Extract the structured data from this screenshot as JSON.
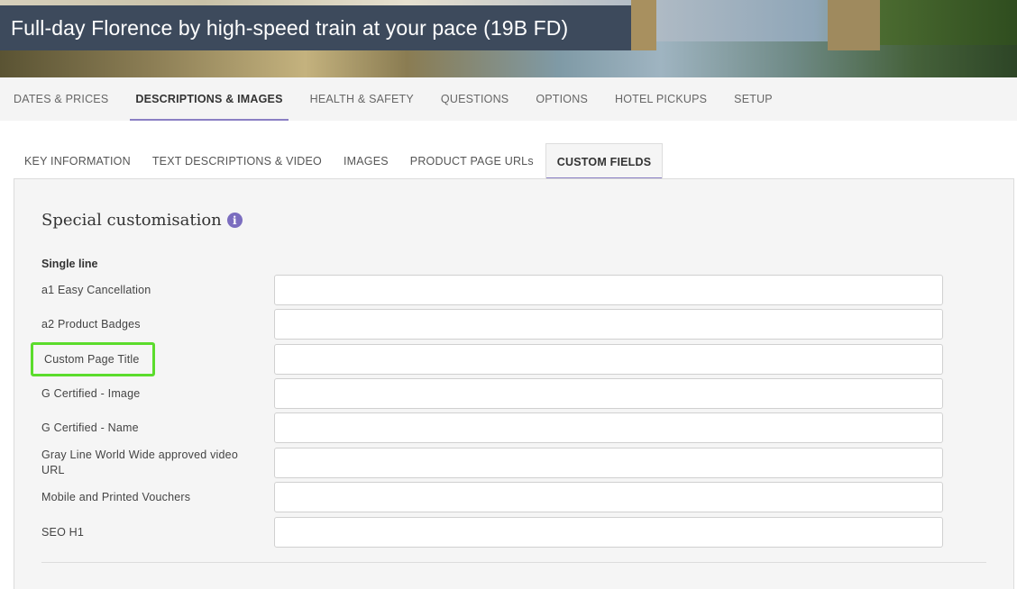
{
  "header": {
    "title": "Full-day Florence by high-speed train at your pace (19B FD)"
  },
  "main_nav": {
    "items": [
      {
        "label": "DATES & PRICES",
        "active": false
      },
      {
        "label": "DESCRIPTIONS & IMAGES",
        "active": true
      },
      {
        "label": "HEALTH & SAFETY",
        "active": false
      },
      {
        "label": "QUESTIONS",
        "active": false
      },
      {
        "label": "OPTIONS",
        "active": false
      },
      {
        "label": "HOTEL PICKUPS",
        "active": false
      },
      {
        "label": "SETUP",
        "active": false
      }
    ]
  },
  "sub_tabs": {
    "items": [
      {
        "label": "KEY INFORMATION",
        "active": false
      },
      {
        "label": "TEXT DESCRIPTIONS & VIDEO",
        "active": false
      },
      {
        "label": "IMAGES",
        "active": false
      },
      {
        "label": "PRODUCT PAGE URLs",
        "active": false
      },
      {
        "label": "CUSTOM FIELDS",
        "active": true
      }
    ]
  },
  "panel": {
    "title": "Special customisation",
    "info_icon": "info-icon",
    "section_label": "Single line",
    "fields": [
      {
        "label": "a1 Easy Cancellation",
        "value": ""
      },
      {
        "label": "a2 Product Badges",
        "value": ""
      },
      {
        "label": "Custom Page Title",
        "value": "",
        "highlighted": true
      },
      {
        "label": "G Certified - Image",
        "value": ""
      },
      {
        "label": "G Certified - Name",
        "value": ""
      },
      {
        "label": "Gray Line World Wide approved video URL",
        "value": ""
      },
      {
        "label": "Mobile and Printed Vouchers",
        "value": ""
      },
      {
        "label": "SEO H1",
        "value": ""
      }
    ]
  },
  "colors": {
    "title_bg": "#3d4a5c",
    "accent": "#8a7fc4",
    "info_icon": "#7b6dbf",
    "highlight": "#5bdc2c"
  }
}
